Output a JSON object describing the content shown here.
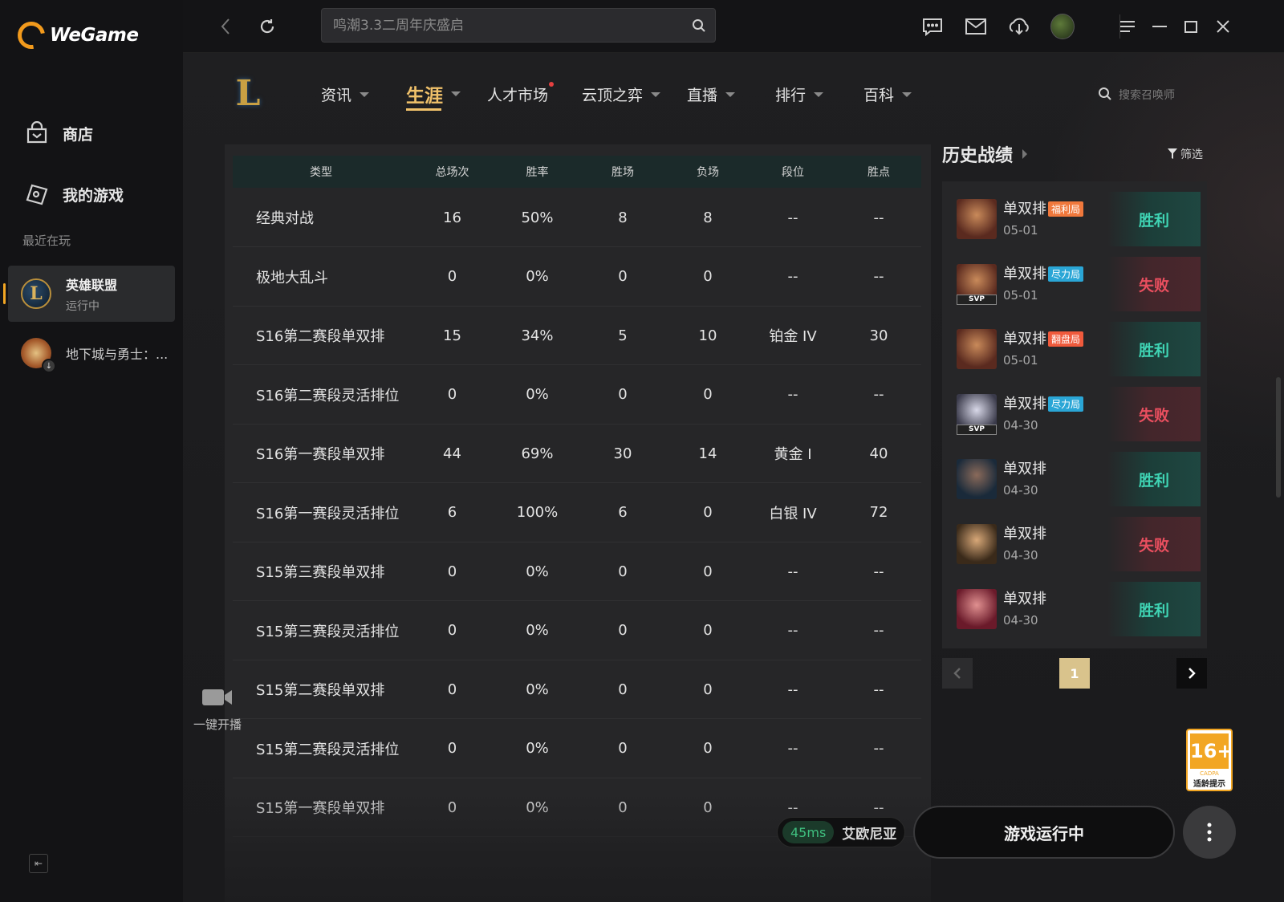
{
  "app": {
    "name": "WeGame"
  },
  "sidebar": {
    "nav": [
      {
        "label": "商店",
        "icon": "store-icon"
      },
      {
        "label": "我的游戏",
        "icon": "game-controller-icon"
      }
    ],
    "recent_title": "最近在玩",
    "recent": [
      {
        "name": "英雄联盟",
        "status": "运行中",
        "icon": "lol-icon"
      },
      {
        "name": "地下城与勇士：...",
        "status": "",
        "icon": "dnf-icon"
      }
    ]
  },
  "topbar": {
    "search_placeholder": "鸣潮3.3二周年庆盛启"
  },
  "game_nav": {
    "tabs": [
      "资讯",
      "生涯",
      "人才市场",
      "云顶之弈",
      "直播",
      "排行",
      "百科"
    ],
    "active_tab": "生涯",
    "summoner_search_placeholder": "搜索召唤师"
  },
  "stats_table": {
    "headers": [
      "类型",
      "总场次",
      "胜率",
      "胜场",
      "负场",
      "段位",
      "胜点"
    ],
    "rows": [
      [
        "经典对战",
        "16",
        "50%",
        "8",
        "8",
        "--",
        "--"
      ],
      [
        "极地大乱斗",
        "0",
        "0%",
        "0",
        "0",
        "--",
        "--"
      ],
      [
        "S16第二赛段单双排",
        "15",
        "34%",
        "5",
        "10",
        "铂金 IV",
        "30"
      ],
      [
        "S16第二赛段灵活排位",
        "0",
        "0%",
        "0",
        "0",
        "--",
        "--"
      ],
      [
        "S16第一赛段单双排",
        "44",
        "69%",
        "30",
        "14",
        "黄金 I",
        "40"
      ],
      [
        "S16第一赛段灵活排位",
        "6",
        "100%",
        "6",
        "0",
        "白银 IV",
        "72"
      ],
      [
        "S15第三赛段单双排",
        "0",
        "0%",
        "0",
        "0",
        "--",
        "--"
      ],
      [
        "S15第三赛段灵活排位",
        "0",
        "0%",
        "0",
        "0",
        "--",
        "--"
      ],
      [
        "S15第二赛段单双排",
        "0",
        "0%",
        "0",
        "0",
        "--",
        "--"
      ],
      [
        "S15第二赛段灵活排位",
        "0",
        "0%",
        "0",
        "0",
        "--",
        "--"
      ],
      [
        "S15第一赛段单双排",
        "0",
        "0%",
        "0",
        "0",
        "--",
        "--"
      ]
    ]
  },
  "broadcast": {
    "label": "一键开播"
  },
  "history": {
    "title": "历史战绩",
    "filter_label": "筛选",
    "matches": [
      {
        "mode": "单双排",
        "tag": "福利局",
        "tag_color": "#f0783c",
        "date": "05-01",
        "result": "胜利",
        "win": true,
        "svp": false,
        "champ_colors": [
          "#5a2a1f",
          "#c98a5a"
        ]
      },
      {
        "mode": "单双排",
        "tag": "尽力局",
        "tag_color": "#2aa6d6",
        "date": "05-01",
        "result": "失败",
        "win": false,
        "svp": true,
        "champ_colors": [
          "#5a2a1f",
          "#c98a5a"
        ]
      },
      {
        "mode": "单双排",
        "tag": "翻盘局",
        "tag_color": "#f05a3c",
        "date": "05-01",
        "result": "胜利",
        "win": true,
        "svp": false,
        "champ_colors": [
          "#5a2a1f",
          "#c98a5a"
        ]
      },
      {
        "mode": "单双排",
        "tag": "尽力局",
        "tag_color": "#2aa6d6",
        "date": "04-30",
        "result": "失败",
        "win": false,
        "svp": true,
        "champ_colors": [
          "#3a3a4a",
          "#d8d8e8"
        ]
      },
      {
        "mode": "单双排",
        "tag": "",
        "tag_color": "",
        "date": "04-30",
        "result": "胜利",
        "win": true,
        "svp": false,
        "champ_colors": [
          "#1a2a3a",
          "#8a6a5a"
        ]
      },
      {
        "mode": "单双排",
        "tag": "",
        "tag_color": "",
        "date": "04-30",
        "result": "失败",
        "win": false,
        "svp": false,
        "champ_colors": [
          "#3a2a1a",
          "#d8a878"
        ]
      },
      {
        "mode": "单双排",
        "tag": "",
        "tag_color": "",
        "date": "04-30",
        "result": "胜利",
        "win": true,
        "svp": false,
        "champ_colors": [
          "#6a1a2a",
          "#e09090"
        ]
      }
    ],
    "svp_label": "SVP"
  },
  "pager": {
    "current": "1"
  },
  "age_rating": {
    "age": "16+",
    "org": "CADPA",
    "tip": "适龄提示"
  },
  "status_bar": {
    "ping": "45ms",
    "server": "艾欧尼亚",
    "launch_label": "游戏运行中"
  }
}
